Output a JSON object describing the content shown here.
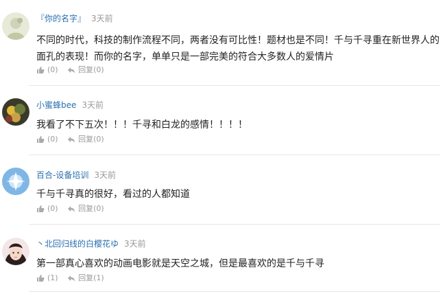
{
  "comments": [
    {
      "username": "『你的名字』",
      "time": "3天前",
      "content": "不同的时代，科技的制作流程不同，两者没有可比性！题材也是不同！千与千寻重在新世界人的面孔的表现！而你的名字，单单只是一部完美的符合大多数人的爱情片",
      "like_count": "(0)",
      "reply_label": "回复(0)"
    },
    {
      "username": "小蜜蜂bee",
      "time": "3天前",
      "content": "我看了不下五次！！！千寻和白龙的感情！！！！",
      "like_count": "(0)",
      "reply_label": "回复(0)"
    },
    {
      "username": "百合-设备培训",
      "time": "3天前",
      "content": "千与千寻真的很好，看过的人都知道",
      "like_count": "(0)",
      "reply_label": "回复(0)"
    },
    {
      "username": "丶北回归线的白樱花ゆ",
      "time": "3天前",
      "content": "第一部真心喜欢的动画电影就是天空之城，但是最喜欢的是千与千寻",
      "like_count": "(1)",
      "reply_label": "回复(1)"
    }
  ],
  "icons": {
    "like": "thumbs-up-icon",
    "reply": "reply-arrow-icon"
  },
  "colors": {
    "username": "#2a6fb0",
    "meta": "#999999",
    "divider": "#e6e6e6"
  }
}
